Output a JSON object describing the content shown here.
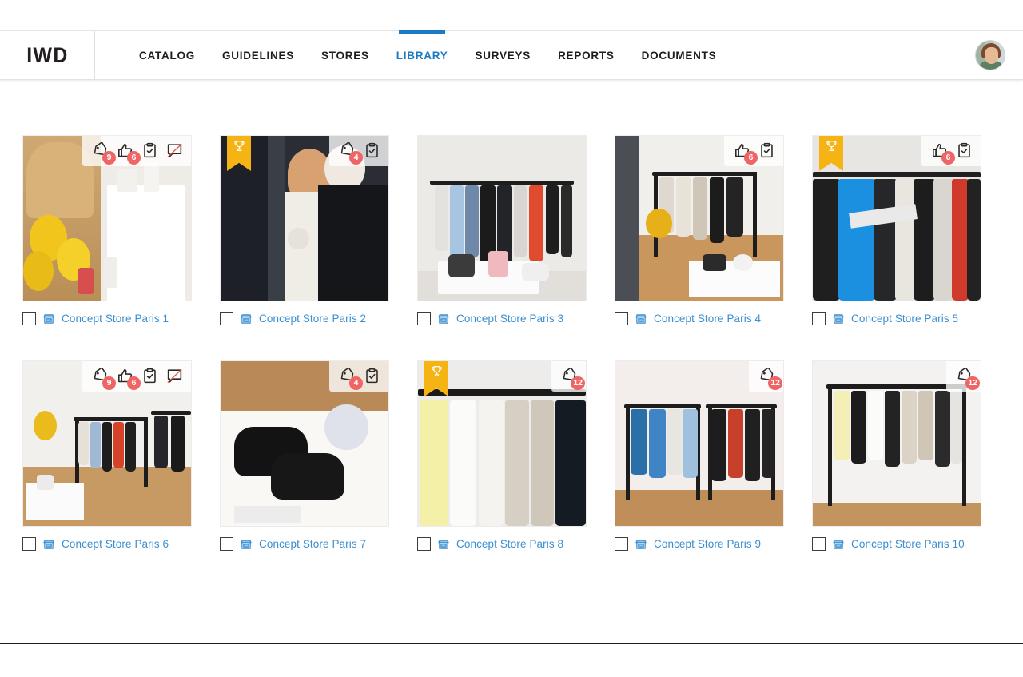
{
  "app": {
    "logo": "IWD"
  },
  "nav": {
    "items": [
      {
        "label": "CATALOG",
        "active": false
      },
      {
        "label": "GUIDELINES",
        "active": false
      },
      {
        "label": "STORES",
        "active": false
      },
      {
        "label": "LIBRARY",
        "active": true
      },
      {
        "label": "SURVEYS",
        "active": false
      },
      {
        "label": "REPORTS",
        "active": false
      },
      {
        "label": "DOCUMENTS",
        "active": false
      }
    ],
    "active_color": "#1a7ac4"
  },
  "user": {
    "avatar_alt": "user-avatar"
  },
  "colors": {
    "accent_blue": "#1a7ac4",
    "link_blue": "#3b8ed0",
    "badge_red": "#ef6464",
    "ribbon_gold": "#f5b414",
    "text_dark": "#1d1d1d"
  },
  "library": {
    "cards": [
      {
        "title": "Concept Store Paris 1",
        "checked": false,
        "award": false,
        "icons": [
          {
            "name": "tag-icon",
            "badge": "9"
          },
          {
            "name": "thumbs-up-icon",
            "badge": "6"
          },
          {
            "name": "clipboard-check-icon",
            "badge": ""
          },
          {
            "name": "comment-disabled-icon",
            "badge": ""
          }
        ]
      },
      {
        "title": "Concept Store Paris 2",
        "checked": false,
        "award": true,
        "icons": [
          {
            "name": "tag-icon",
            "badge": "4"
          },
          {
            "name": "clipboard-check-icon",
            "badge": ""
          }
        ]
      },
      {
        "title": "Concept Store Paris 3",
        "checked": false,
        "award": false,
        "icons": []
      },
      {
        "title": "Concept Store Paris 4",
        "checked": false,
        "award": false,
        "icons": [
          {
            "name": "thumbs-up-icon",
            "badge": "6"
          },
          {
            "name": "clipboard-check-icon",
            "badge": ""
          }
        ]
      },
      {
        "title": "Concept Store Paris 5",
        "checked": false,
        "award": true,
        "icons": [
          {
            "name": "thumbs-up-icon",
            "badge": "6"
          },
          {
            "name": "clipboard-check-icon",
            "badge": ""
          }
        ]
      },
      {
        "title": "Concept Store Paris 6",
        "checked": false,
        "award": false,
        "icons": [
          {
            "name": "tag-icon",
            "badge": "9"
          },
          {
            "name": "thumbs-up-icon",
            "badge": "6"
          },
          {
            "name": "clipboard-check-icon",
            "badge": ""
          },
          {
            "name": "comment-disabled-icon",
            "badge": ""
          }
        ]
      },
      {
        "title": "Concept Store Paris 7",
        "checked": false,
        "award": false,
        "icons": [
          {
            "name": "tag-icon",
            "badge": "4"
          },
          {
            "name": "clipboard-check-icon",
            "badge": ""
          }
        ]
      },
      {
        "title": "Concept Store Paris 8",
        "checked": false,
        "award": true,
        "icons": [
          {
            "name": "tag-icon",
            "badge": "12"
          }
        ]
      },
      {
        "title": "Concept Store Paris 9",
        "checked": false,
        "award": false,
        "icons": [
          {
            "name": "tag-icon",
            "badge": "12"
          }
        ]
      },
      {
        "title": "Concept Store Paris 10",
        "checked": false,
        "award": false,
        "icons": [
          {
            "name": "tag-icon",
            "badge": "12"
          }
        ]
      }
    ]
  }
}
